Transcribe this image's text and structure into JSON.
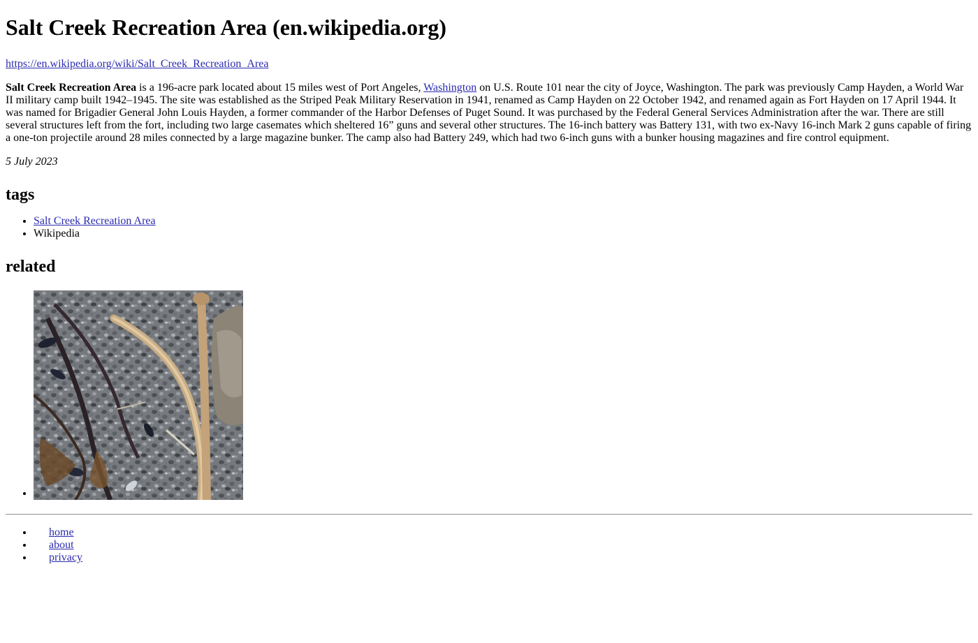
{
  "page": {
    "title": "Salt Creek Recreation Area (en.wikipedia.org)",
    "url": "https://en.wikipedia.org/wiki/Salt_Creek_Recreation_Area",
    "desc_bold": "Salt Creek Recreation Area",
    "desc_part1": " is a 196-acre park located about 15 miles west of Port Angeles, ",
    "desc_link": "Washington",
    "desc_part2": " on U.S. Route 101 near the city of Joyce, Washington. The park was previously Camp Hayden, a World War II military camp built 1942–1945. The site was established as the Striped Peak Military Reservation in 1941, renamed as Camp Hayden on 22 October 1942, and renamed again as Fort Hayden on 17 April 1944. It was named for Brigadier General John Louis Hayden, a former commander of the Harbor Defenses of Puget Sound. It was purchased by the Federal General Services Administration after the war. There are still several structures left from the fort, including two large casemates which sheltered 16” guns and several other structures. The 16-inch battery was Battery 131, with two ex-Navy 16-inch Mark 2 guns capable of firing a one-ton projectile around 28 miles connected by a large magazine bunker. The camp also had Battery 249, which had two 6-inch guns with a bunker housing magazines and fire control equipment.",
    "date": "5 July 2023"
  },
  "tags": {
    "heading": "tags",
    "items": [
      {
        "label": "Salt Creek Recreation Area",
        "link": true
      },
      {
        "label": "Wikipedia",
        "link": false
      }
    ]
  },
  "related": {
    "heading": "related"
  },
  "footer": {
    "links": [
      "home",
      "about",
      "privacy"
    ]
  },
  "colors": {
    "link": "#2b2bb0",
    "text": "#000000",
    "background": "#ffffff"
  }
}
